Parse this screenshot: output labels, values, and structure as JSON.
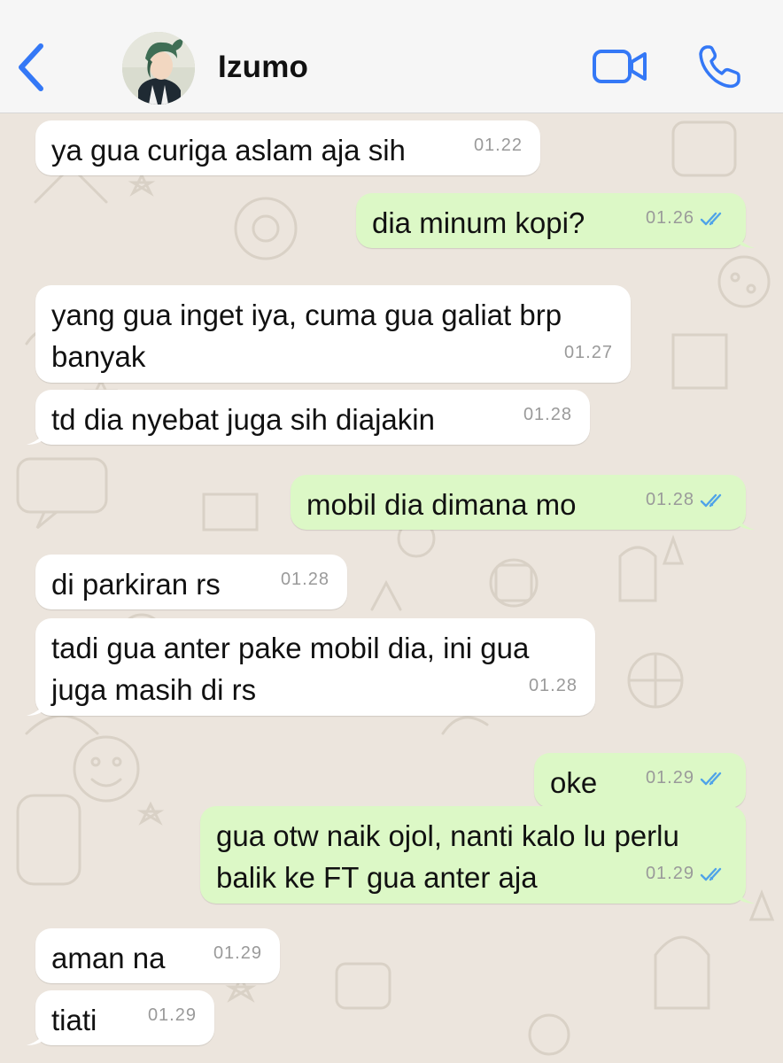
{
  "header": {
    "contact_name": "Izumo",
    "back_icon": "chevron-left-icon",
    "video_icon": "video-camera-icon",
    "call_icon": "phone-icon",
    "accent_color": "#3478f6"
  },
  "colors": {
    "incoming_bubble": "#ffffff",
    "outgoing_bubble": "#dcf8c6",
    "read_ticks": "#4fa3e8",
    "wallpaper": "#ece5dd"
  },
  "messages": [
    {
      "direction": "in",
      "text": "ya gua curiga aslam aja sih",
      "time": "01.22"
    },
    {
      "direction": "out",
      "text": "dia minum kopi?",
      "time": "01.26",
      "status": "read"
    },
    {
      "direction": "in",
      "text": "yang gua inget iya, cuma gua galiat brp\nbanyak",
      "time": "01.27"
    },
    {
      "direction": "in",
      "text": "td dia nyebat juga sih diajakin",
      "time": "01.28"
    },
    {
      "direction": "out",
      "text": "mobil dia dimana mo",
      "time": "01.28",
      "status": "read"
    },
    {
      "direction": "in",
      "text": "di parkiran rs",
      "time": "01.28"
    },
    {
      "direction": "in",
      "text": "tadi gua anter pake mobil dia, ini gua\njuga masih di rs",
      "time": "01.28"
    },
    {
      "direction": "out",
      "text": "oke",
      "time": "01.29",
      "status": "read"
    },
    {
      "direction": "out",
      "text": "gua otw naik ojol, nanti kalo lu perlu\nbalik ke FT gua anter aja",
      "time": "01.29",
      "status": "read"
    },
    {
      "direction": "in",
      "text": "aman na",
      "time": "01.29"
    },
    {
      "direction": "in",
      "text": "tiati",
      "time": "01.29"
    }
  ]
}
